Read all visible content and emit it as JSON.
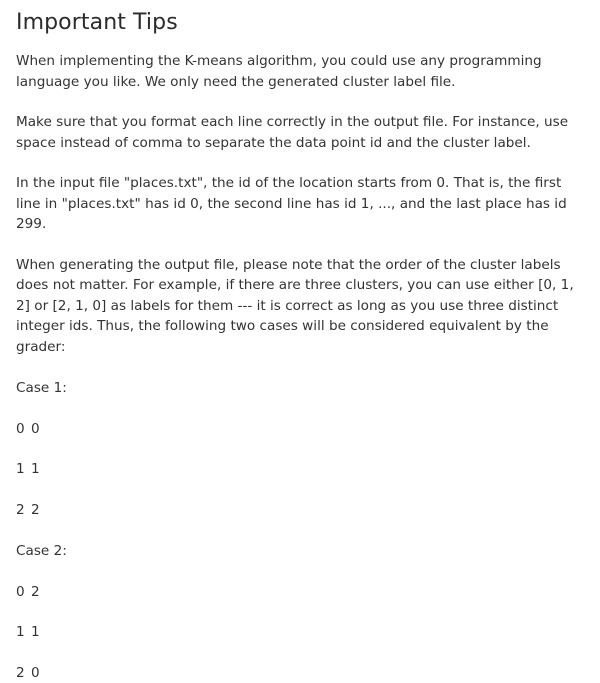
{
  "title": "Important Tips",
  "paragraphs": [
    "When implementing the K-means algorithm, you could use any programming language you like. We only need the generated cluster label file.",
    "Make sure that you format each line correctly in the output file. For instance, use space instead of comma to separate the data point id and the cluster label.",
    "In the input file \"places.txt\", the id of the location starts from 0. That is, the first line in \"places.txt\" has id 0, the second line has id 1, ..., and the last place has id 299.",
    "When generating the output file, please note that the order of the cluster labels does not matter. For example, if there are three clusters, you can use either [0, 1, 2] or [2, 1, 0] as labels for them --- it is correct as long as you use three distinct integer ids. Thus, the following two cases will be considered equivalent by the grader:"
  ],
  "case1": {
    "label": "Case 1:",
    "lines": [
      "0 0",
      "1 1",
      "2 2"
    ]
  },
  "case2": {
    "label": "Case 2:",
    "lines": [
      "0 2",
      "1 1",
      "2 0"
    ]
  }
}
